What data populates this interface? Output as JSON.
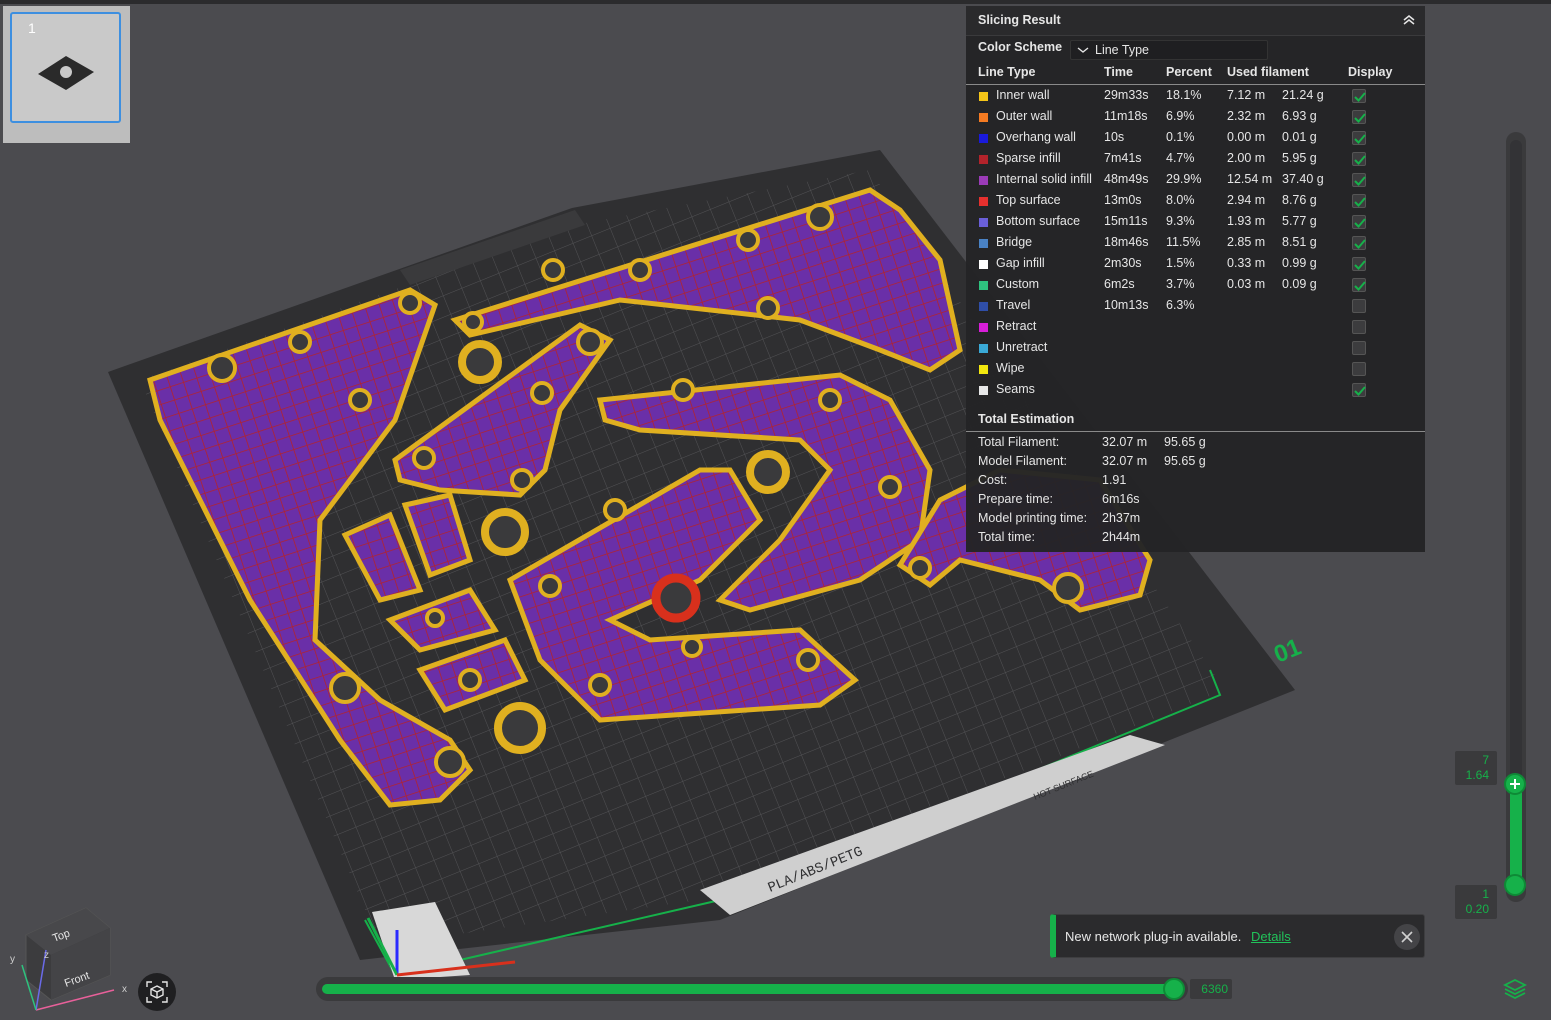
{
  "plate": {
    "number": "1"
  },
  "slicing_result": {
    "title": "Slicing Result",
    "color_scheme_label": "Color Scheme",
    "color_scheme_value": "Line Type",
    "columns": {
      "line_type": "Line Type",
      "time": "Time",
      "percent": "Percent",
      "used_filament": "Used filament",
      "display": "Display"
    },
    "line_types": [
      {
        "name": "Inner wall",
        "color": "#f5c518",
        "time": "29m33s",
        "percent": "18.1%",
        "length": "7.12 m",
        "weight": "21.24 g",
        "display": true
      },
      {
        "name": "Outer wall",
        "color": "#f57b22",
        "time": "11m18s",
        "percent": "6.9%",
        "length": "2.32 m",
        "weight": "6.93 g",
        "display": true
      },
      {
        "name": "Overhang wall",
        "color": "#1a1adb",
        "time": "10s",
        "percent": "0.1%",
        "length": "0.00 m",
        "weight": "0.01 g",
        "display": true
      },
      {
        "name": "Sparse infill",
        "color": "#b3232b",
        "time": "7m41s",
        "percent": "4.7%",
        "length": "2.00 m",
        "weight": "5.95 g",
        "display": true
      },
      {
        "name": "Internal solid infill",
        "color": "#9b3bb8",
        "time": "48m49s",
        "percent": "29.9%",
        "length": "12.54 m",
        "weight": "37.40 g",
        "display": true
      },
      {
        "name": "Top surface",
        "color": "#e6302e",
        "time": "13m0s",
        "percent": "8.0%",
        "length": "2.94 m",
        "weight": "8.76 g",
        "display": true
      },
      {
        "name": "Bottom surface",
        "color": "#6a5fd8",
        "time": "15m11s",
        "percent": "9.3%",
        "length": "1.93 m",
        "weight": "5.77 g",
        "display": true
      },
      {
        "name": "Bridge",
        "color": "#4a82c4",
        "time": "18m46s",
        "percent": "11.5%",
        "length": "2.85 m",
        "weight": "8.51 g",
        "display": true
      },
      {
        "name": "Gap infill",
        "color": "#ffffff",
        "time": "2m30s",
        "percent": "1.5%",
        "length": "0.33 m",
        "weight": "0.99 g",
        "display": true
      },
      {
        "name": "Custom",
        "color": "#2ec27e",
        "time": "6m2s",
        "percent": "3.7%",
        "length": "0.03 m",
        "weight": "0.09 g",
        "display": true
      },
      {
        "name": "Travel",
        "color": "#2f4ea8",
        "time": "10m13s",
        "percent": "6.3%",
        "length": "",
        "weight": "",
        "display": false
      },
      {
        "name": "Retract",
        "color": "#d81ed8",
        "time": "",
        "percent": "",
        "length": "",
        "weight": "",
        "display": false
      },
      {
        "name": "Unretract",
        "color": "#3aa9d6",
        "time": "",
        "percent": "",
        "length": "",
        "weight": "",
        "display": false
      },
      {
        "name": "Wipe",
        "color": "#f2e70f",
        "time": "",
        "percent": "",
        "length": "",
        "weight": "",
        "display": false
      },
      {
        "name": "Seams",
        "color": "#e8e8e8",
        "time": "",
        "percent": "",
        "length": "",
        "weight": "",
        "display": true
      }
    ],
    "total_title": "Total Estimation",
    "totals": [
      {
        "label": "Total Filament:",
        "value": "32.07 m",
        "value2": "95.65 g"
      },
      {
        "label": "Model Filament:",
        "value": "32.07 m",
        "value2": "95.65 g"
      },
      {
        "label": "Cost:",
        "value": "1.91",
        "value2": ""
      },
      {
        "label": "Prepare time:",
        "value": "6m16s",
        "value2": ""
      },
      {
        "label": "Model printing time:",
        "value": "2h37m",
        "value2": ""
      },
      {
        "label": "Total time:",
        "value": "2h44m",
        "value2": ""
      }
    ]
  },
  "layer_slider": {
    "top_layer": "7",
    "top_height": "1.64",
    "bottom_layer": "1",
    "bottom_height": "0.20"
  },
  "move_slider": {
    "value": "6360"
  },
  "notification": {
    "text": "New network plug-in available.",
    "link": "Details"
  },
  "bed": {
    "label": "PLA/ABS/PETG",
    "warning": "HOT SURFACE",
    "plate_number": "01"
  },
  "view_cube": {
    "top": "Top",
    "front": "Front",
    "axis_x": "x",
    "axis_y": "y",
    "axis_z": "z"
  },
  "colors": {
    "accent": "#16b14a",
    "wall": "#e0b020",
    "infill": "#7a2fa0",
    "grid_line": "#a8232b"
  }
}
